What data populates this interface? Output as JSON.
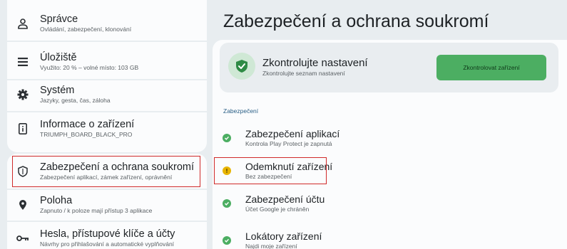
{
  "sidebar": {
    "items": [
      {
        "title": "Správce",
        "subtitle": "Ovládání, zabezpečení, klonování",
        "icon": "person-icon"
      },
      {
        "title": "Úložiště",
        "subtitle": "Využito: 20 % – volné místo: 103 GB",
        "icon": "storage-icon"
      },
      {
        "title": "Systém",
        "subtitle": "Jazyky, gesta, čas, záloha",
        "icon": "gear-icon"
      },
      {
        "title": "Informace o zařízení",
        "subtitle": "TRIUMPH_BOARD_BLACK_PRO",
        "icon": "device-info-icon"
      },
      {
        "title": "Zabezpečení a ochrana soukromí",
        "subtitle": "Zabezpečení aplikací, zámek zařízení, oprávnění",
        "icon": "shield-icon"
      },
      {
        "title": "Poloha",
        "subtitle": "Zapnuto / k poloze mají přístup 3 aplikace",
        "icon": "location-pin-icon"
      },
      {
        "title": "Hesla, přístupové klíče a účty",
        "subtitle": "Návrhy pro přihlašování a automatické vyplňování",
        "icon": "key-icon"
      }
    ]
  },
  "main": {
    "title": "Zabezpečení a ochrana soukromí",
    "check": {
      "title": "Zkontrolujte nastavení",
      "subtitle": "Zkontrolujte seznam nastavení",
      "button": "Zkontrolovat zařízení"
    },
    "section_label": "Zabezpečení",
    "items": [
      {
        "title": "Zabezpečení aplikací",
        "subtitle": "Kontrola Play Protect je zapnutá",
        "status": "ok"
      },
      {
        "title": "Odemknutí zařízení",
        "subtitle": "Bez zabezpečení",
        "status": "warning"
      },
      {
        "title": "Zabezpečení účtu",
        "subtitle": "Účet Google je chráněn",
        "status": "ok"
      },
      {
        "title": "Lokátory zařízení",
        "subtitle": "Najdi moje zařízení",
        "status": "ok"
      }
    ]
  },
  "colors": {
    "ok": "#4cae62",
    "warning": "#e8b400",
    "highlight": "#d02a2a",
    "accent_text": "#2a5f86"
  }
}
